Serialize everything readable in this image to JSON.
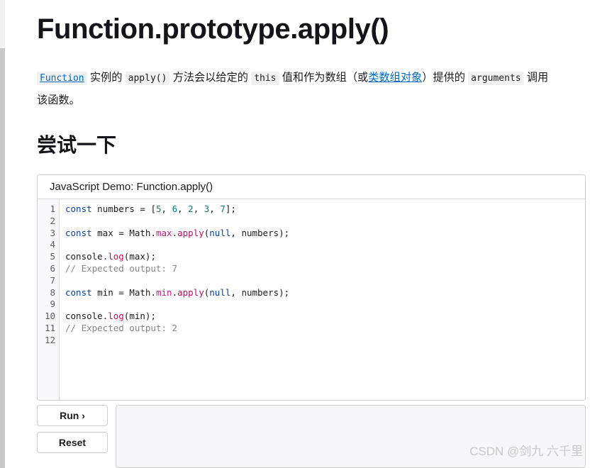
{
  "page": {
    "title": "Function.prototype.apply()",
    "try_heading": "尝试一下"
  },
  "intro": {
    "link_function": "Function",
    "text_1": " 实例的 ",
    "code_apply": "apply()",
    "text_2": " 方法会以给定的 ",
    "code_this": "this",
    "text_3": " 值和作为数组（或",
    "link_arraylike": "类数组对象",
    "text_4": "）提供的 ",
    "code_arguments": "arguments",
    "text_5": " 调用该函数。"
  },
  "editor": {
    "header": "JavaScript Demo: Function.apply()",
    "line_numbers": [
      "1",
      "2",
      "3",
      "4",
      "5",
      "6",
      "7",
      "8",
      "9",
      "10",
      "11",
      "12"
    ],
    "code_lines": [
      "const numbers = [5, 6, 2, 3, 7];",
      "",
      "const max = Math.max.apply(null, numbers);",
      "",
      "console.log(max);",
      "// Expected output: 7",
      "",
      "const min = Math.min.apply(null, numbers);",
      "",
      "console.log(min);",
      "// Expected output: 2",
      ""
    ]
  },
  "controls": {
    "run_label": "Run ›",
    "reset_label": "Reset"
  },
  "output": {
    "content": ""
  },
  "watermark": {
    "text": "CSDN @剑九 六千里"
  },
  "colors": {
    "link": "#0069c2",
    "keyword": "#0842a0",
    "number": "#0b7c8c",
    "property": "#c71585",
    "function": "#cc0a5e",
    "comment": "#868686",
    "border": "#cdcdcd",
    "gutter_bg": "#f9f9fb",
    "output_bg": "#f7f7f9",
    "watermark": "#c9c9c9"
  }
}
